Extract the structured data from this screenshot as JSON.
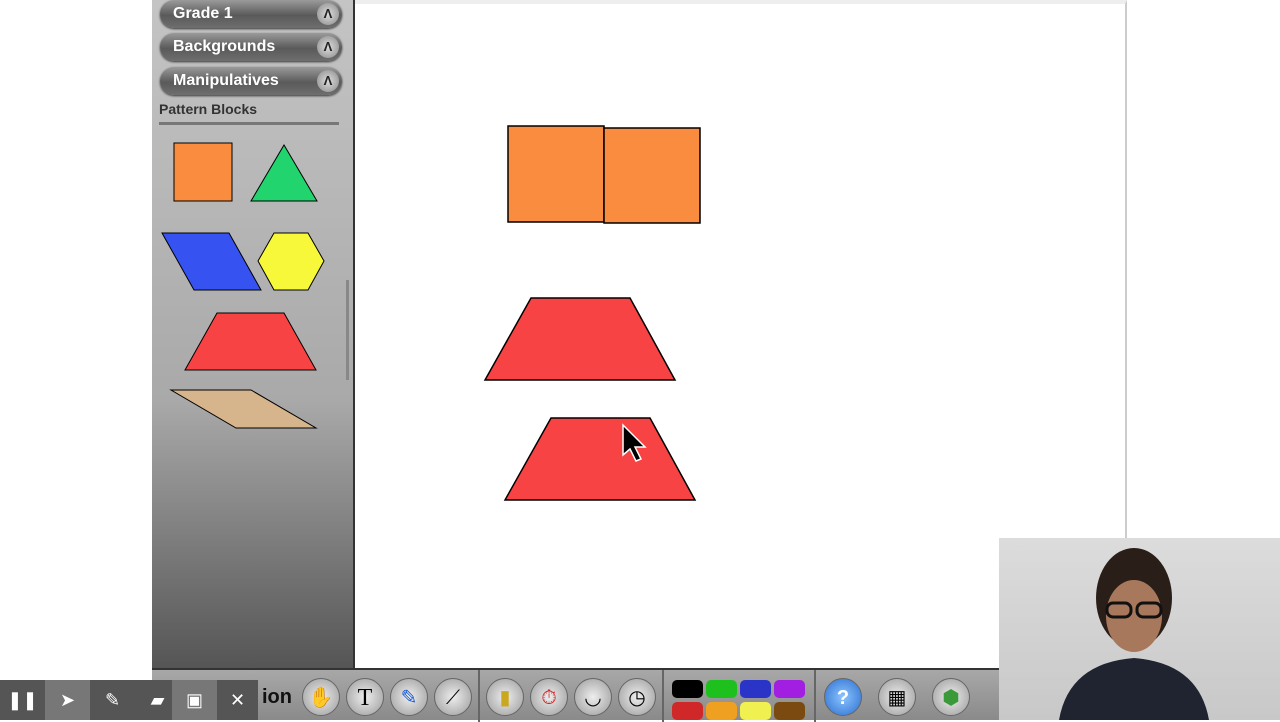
{
  "sidebar": {
    "accordions": [
      {
        "label": "Grade 1"
      },
      {
        "label": "Backgrounds"
      },
      {
        "label": "Manipulatives"
      }
    ],
    "section_title": "Pattern Blocks",
    "blocks": [
      "square",
      "triangle",
      "rhombus",
      "hexagon",
      "trapezoid",
      "thin-rhombus"
    ]
  },
  "video_controls": {
    "overlay_text": "ion"
  },
  "toolbar": {
    "tools": [
      "hand",
      "text",
      "pen",
      "line",
      "ruler",
      "timer",
      "protractor",
      "dial"
    ],
    "colors": [
      "#000000",
      "#1ec01e",
      "#2a35c8",
      "#a21ee0",
      "#d02828",
      "#f0a020",
      "#f0f050",
      "#7a4a10"
    ],
    "help_label": "?",
    "apps": [
      "table",
      "manipulatives"
    ]
  },
  "canvas": {
    "colors": {
      "square": "#f98c3e",
      "trapezoid": "#f74343",
      "triangle": "#22d46e",
      "hexagon": "#f8f83a",
      "rhombus": "#3652f0",
      "tan": "#d6b48c"
    }
  }
}
